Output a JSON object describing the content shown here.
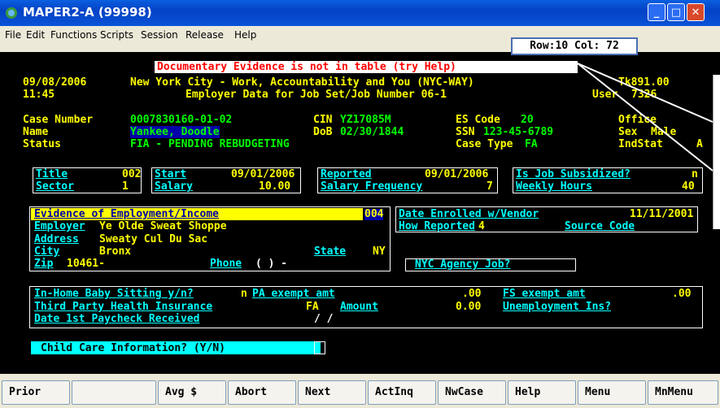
{
  "window": {
    "title": "MAPER2-A (99998)",
    "row_col": "Row:10 Col: 72"
  },
  "menu": [
    "File",
    "Edit",
    "Functions",
    "Scripts",
    "Session",
    "Release",
    "Help"
  ],
  "screen": {
    "error_message": "Documentary Evidence is not in table (try Help)",
    "date": "09/08/2006",
    "time": "11:45",
    "header_title": "New York City - Work, Accountability and You (NYC-WAY)",
    "screen_id": "Tk891.00",
    "subtitle": "Employer Data for Job Set/Job Number 06-1",
    "user_label": "User",
    "user_value": "7326",
    "case_number_label": "Case Number",
    "case_number": "0007830160-01-02",
    "cin_label": "CIN",
    "cin": "YZ17085M",
    "es_code_label": "ES Code",
    "es_code": "20",
    "office_label": "Office",
    "name_label": "Name",
    "name": "Yankee, Doodle",
    "dob_label": "DoB",
    "dob": "02/30/1844",
    "ssn_label": "SSN",
    "ssn": "123-45-6789",
    "sex_label": "Sex",
    "sex": "Male",
    "status_label": "Status",
    "status": "FIA - PENDING REBUDGETING",
    "case_type_label": "Case Type",
    "case_type": "FA",
    "indstat_label": "IndStat",
    "indstat": "A",
    "title_label": "Title",
    "title_value": "002",
    "start_label": "Start",
    "start_value": "09/01/2006",
    "reported_label": "Reported",
    "reported_value": "09/01/2006",
    "subsidized_label": "Is Job Subsidized?",
    "subsidized_value": "n",
    "sector_label": "Sector",
    "sector_value": "1",
    "salary_label": "Salary",
    "salary_value": "10.00",
    "salary_freq_label": "Salary Frequency",
    "salary_freq_value": "7",
    "weekly_hours_label": "Weekly Hours",
    "weekly_hours_value": "40",
    "evidence_label": "Evidence of Employment/Income",
    "evidence_value": "004",
    "date_enrolled_label": "Date Enrolled w/Vendor",
    "date_enrolled_value": "11/11/2001",
    "employer_label": "Employer",
    "employer_value": "Ye Olde Sweat Shoppe",
    "how_reported_label": "How Reported",
    "how_reported_value": "4",
    "source_code_label": "Source Code",
    "address_label": "Address",
    "address_value": "Sweaty Cul Du Sac",
    "city_label": "City",
    "city_value": "Bronx",
    "state_label": "State",
    "state_value": "NY",
    "zip_label": "Zip",
    "zip_value": "10461-",
    "phone_label": "Phone",
    "phone_value": "(    )    -",
    "nyc_agency_label": "NYC Agency Job?",
    "baby_sitting_label": "In-Home Baby Sitting y/n?",
    "baby_sitting_value": "n",
    "pa_exempt_label": "PA exempt amt",
    "pa_exempt_value": ".00",
    "fs_exempt_label": "FS exempt amt",
    "fs_exempt_value": ".00",
    "third_party_label": "Third Party Health Insurance",
    "third_party_value": "FA",
    "amount_label": "Amount",
    "amount_value": "0.00",
    "unemployment_label": "Unemployment Ins?",
    "paycheck_label": "Date 1st Paycheck Received",
    "paycheck_value": "/  /",
    "child_care_label": "Child Care Information? (Y/N)"
  },
  "fkeys": [
    "Prior",
    "",
    "Avg $",
    "Abort",
    "Next",
    "ActInq",
    "NwCase",
    "Help",
    "Menu",
    "MnMenu"
  ]
}
